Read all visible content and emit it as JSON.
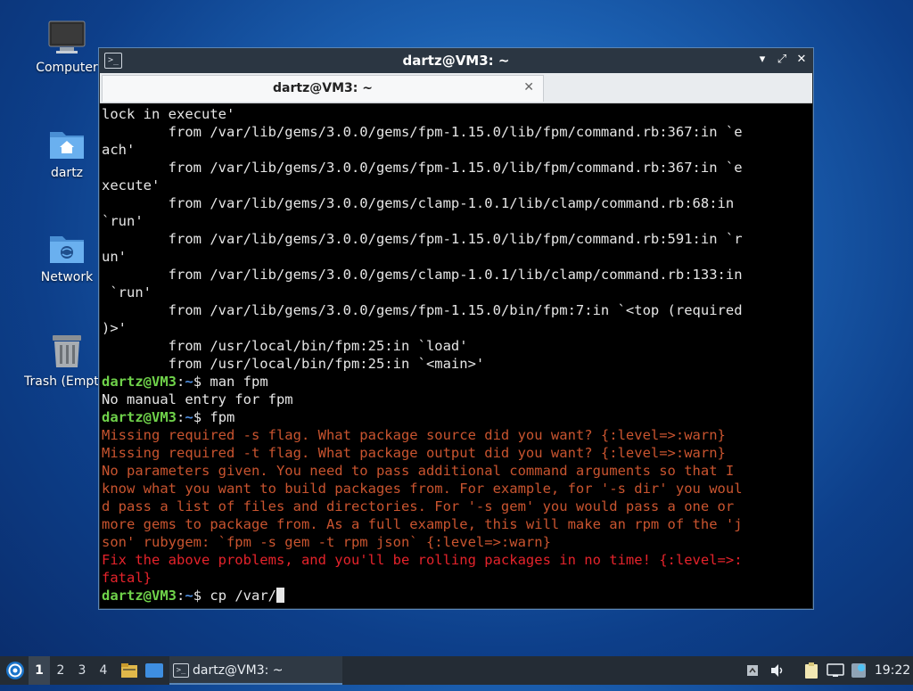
{
  "desktop": {
    "icons": [
      {
        "label": "Computer"
      },
      {
        "label": "dartz"
      },
      {
        "label": "Network"
      },
      {
        "label": "Trash (Empty)"
      }
    ]
  },
  "window": {
    "title": "dartz@VM3: ~",
    "controls": {
      "minimize": "▾",
      "restore": "⤢",
      "close": "✕"
    }
  },
  "tab": {
    "label": "dartz@VM3: ~",
    "close": "✕"
  },
  "terminal": {
    "lines": [
      "lock in execute'",
      "        from /var/lib/gems/3.0.0/gems/fpm-1.15.0/lib/fpm/command.rb:367:in `e",
      "ach'",
      "        from /var/lib/gems/3.0.0/gems/fpm-1.15.0/lib/fpm/command.rb:367:in `e",
      "xecute'",
      "        from /var/lib/gems/3.0.0/gems/clamp-1.0.1/lib/clamp/command.rb:68:in",
      "`run'",
      "        from /var/lib/gems/3.0.0/gems/fpm-1.15.0/lib/fpm/command.rb:591:in `r",
      "un'",
      "        from /var/lib/gems/3.0.0/gems/clamp-1.0.1/lib/clamp/command.rb:133:in",
      " `run'",
      "        from /var/lib/gems/3.0.0/gems/fpm-1.15.0/bin/fpm:7:in `<top (required",
      ")>'",
      "        from /usr/local/bin/fpm:25:in `load'",
      "        from /usr/local/bin/fpm:25:in `<main>'"
    ],
    "prompt_user": "dartz@VM3",
    "prompt_sep": ":",
    "prompt_path": "~",
    "prompt_sym": "$ ",
    "cmd1": "man fpm",
    "out1": "No manual entry for fpm",
    "cmd2": "fpm",
    "warn_lines": [
      "Missing required -s flag. What package source did you want? {:level=>:warn}",
      "Missing required -t flag. What package output did you want? {:level=>:warn}",
      "No parameters given. You need to pass additional command arguments so that I",
      "know what you want to build packages from. For example, for '-s dir' you woul",
      "d pass a list of files and directories. For '-s gem' you would pass a one or",
      "more gems to package from. As a full example, this will make an rpm of the 'j",
      "son' rubygem: `fpm -s gem -t rpm json` {:level=>:warn}"
    ],
    "fatal_lines": [
      "Fix the above problems, and you'll be rolling packages in no time! {:level=>:",
      "fatal}"
    ],
    "cmd3": "cp /var/"
  },
  "taskbar": {
    "workspaces": [
      "1",
      "2",
      "3",
      "4"
    ],
    "task_label": "dartz@VM3: ~",
    "clock": "19:22"
  },
  "colors": {
    "prompt_user": "#6fd24a",
    "prompt_path": "#4f8fe0",
    "warn": "#c9542f",
    "fatal": "#e5232b"
  }
}
